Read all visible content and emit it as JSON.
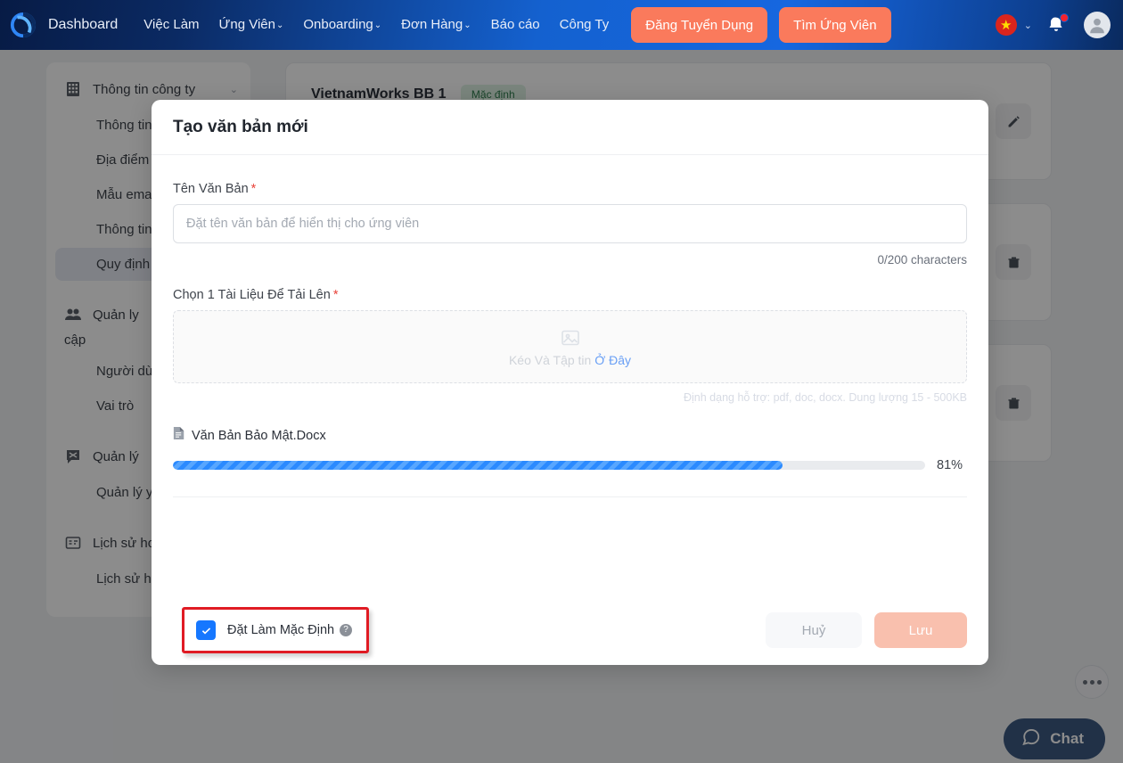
{
  "navbar": {
    "logo_icon": "vietnamworks-logo-icon",
    "brand_label": "Dashboard",
    "links": [
      {
        "label": "Việc Làm",
        "caret": false
      },
      {
        "label": "Ứng Viên",
        "caret": true
      },
      {
        "label": "Onboarding",
        "caret": true
      },
      {
        "label": "Đơn Hàng",
        "caret": true
      },
      {
        "label": "Báo cáo",
        "caret": false
      },
      {
        "label": "Công Ty",
        "caret": false
      }
    ],
    "cta_post_job": "Đăng Tuyển Dụng",
    "cta_find_candidate": "Tìm Ứng Viên",
    "caret_glyph": "⌄",
    "flag_glyph": "★",
    "flag_color": "#da251d",
    "flag_star_color": "#ffde00",
    "cta_color": "#fa7a5c",
    "bell_icon": "notification-bell-icon",
    "bell_badge_color": "#f5222d",
    "avatar_icon": "user-avatar-icon"
  },
  "sidebar": {
    "groups": [
      {
        "icon": "building-icon",
        "label": "Thông tin công ty",
        "caret": "⌄",
        "items": [
          {
            "label": "Thông tin c",
            "active": false
          },
          {
            "label": "Địa điểm là",
            "active": false
          },
          {
            "label": "Mẫu email",
            "active": false
          },
          {
            "label": "Thông tin p",
            "active": false
          },
          {
            "label": "Quy định b",
            "active": true
          }
        ]
      },
      {
        "icon": "users-icon",
        "label": "Quản ly",
        "label_wrap": "cập",
        "caret": "",
        "items": [
          {
            "label": "Người dùn",
            "active": false
          },
          {
            "label": "Vai trò",
            "active": false
          }
        ]
      },
      {
        "icon": "megaphone-icon",
        "label": "Quản lý",
        "caret": "",
        "items": [
          {
            "label": "Quản lý yê",
            "active": false
          }
        ]
      },
      {
        "icon": "activity-log-icon",
        "label": "Lịch sử hoạt động",
        "caret": "⌄",
        "items": [
          {
            "label": "Lịch sử hoạt động",
            "active": false
          }
        ]
      }
    ]
  },
  "background_content": {
    "cards": [
      {
        "title": "VietnamWorks BB 1",
        "badge": "Mặc định",
        "action_icon": "edit-pencil-icon"
      },
      {
        "title": "",
        "badge": "",
        "action_icon": "trash-icon"
      },
      {
        "title": "",
        "badge": "",
        "action_icon": "trash-icon"
      }
    ],
    "chat_label": "Chat",
    "chat_icon": "chat-bubble-icon",
    "more_icon": "more-dots-icon"
  },
  "modal": {
    "title": "Tạo văn bản mới",
    "name_field": {
      "label": "Tên Văn Bản",
      "required_marker": "*",
      "value": "",
      "placeholder": "Đặt tên văn bản để hiển thị cho ứng viên",
      "char_count": "0/200 characters"
    },
    "upload_field": {
      "label": "Chọn 1 Tài Liệu Để Tải Lên",
      "required_marker": "*",
      "dropzone_icon": "image-placeholder-icon",
      "dropzone_text": "Kéo Và Tập tin",
      "dropzone_link": "Ở Đây",
      "hint": "Định dạng hỗ trợ: pdf, doc, docx. Dung lượng 15 - 500KB"
    },
    "uploading_file": {
      "file_icon": "document-file-icon",
      "name": "Văn Bản Bảo Mật.Docx",
      "progress_percent": 81,
      "progress_label": "81%",
      "bar_color": "#2b8aff"
    },
    "default_checkbox": {
      "checked": true,
      "label": "Đặt Làm Mặc Định",
      "help_icon": "question-mark-icon",
      "highlight_color": "#e01b24"
    },
    "buttons": {
      "cancel": "Huỷ",
      "save": "Lưu",
      "save_color": "#f9c0ae"
    }
  }
}
